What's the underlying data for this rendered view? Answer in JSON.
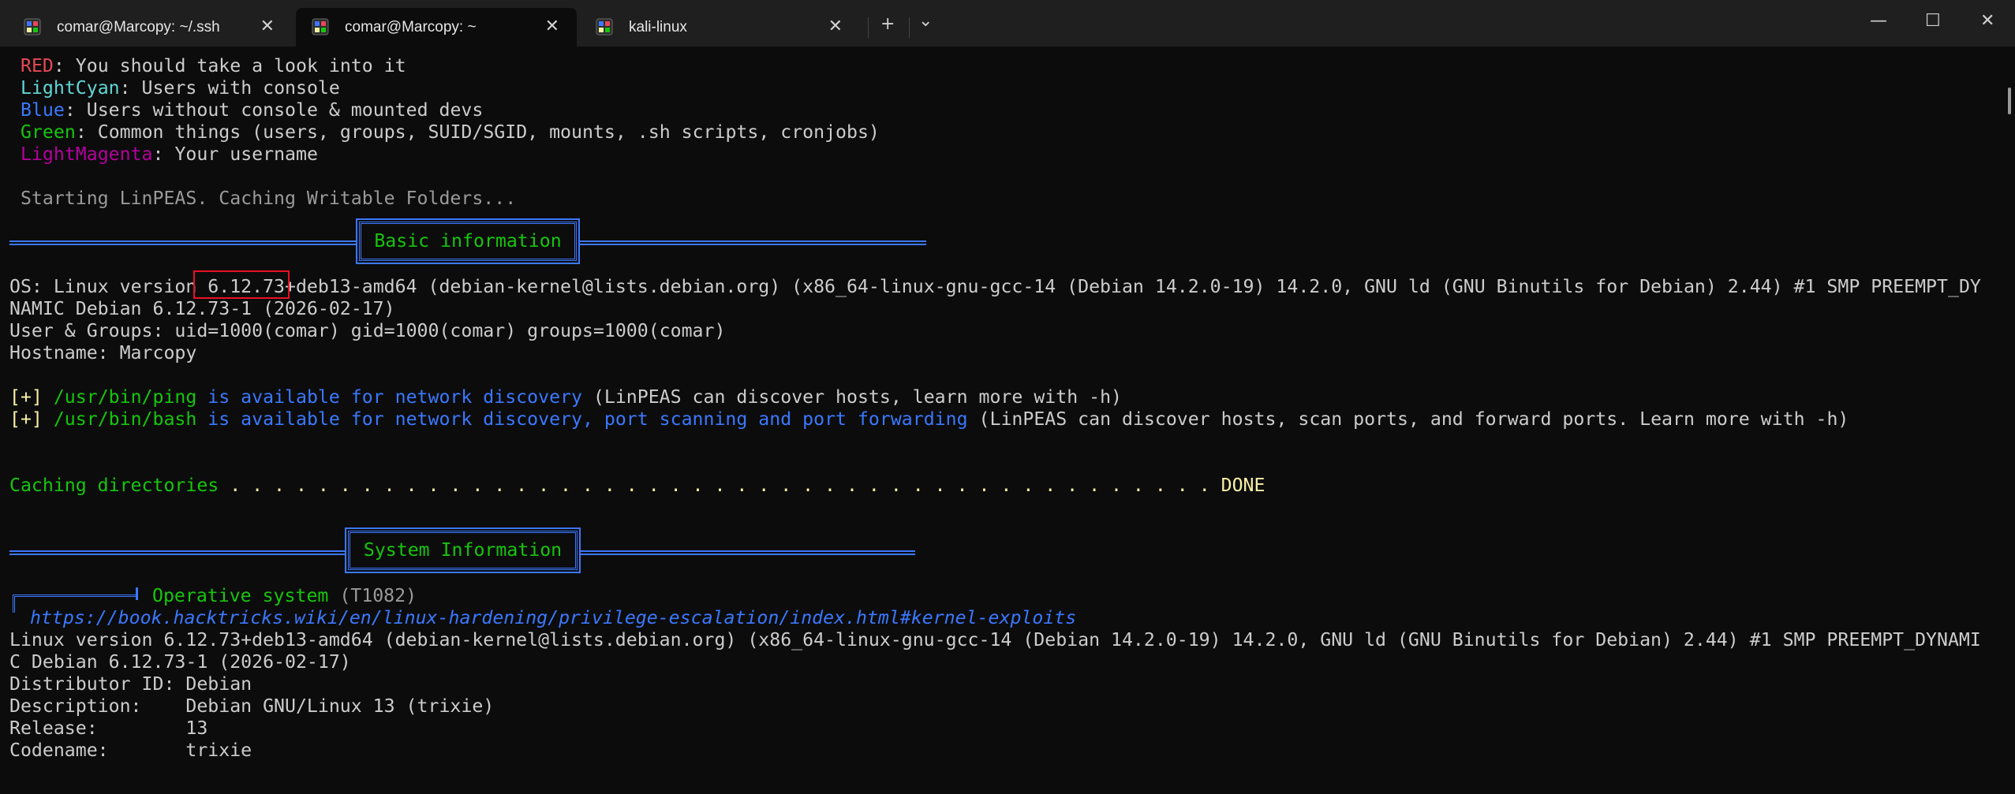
{
  "tabs": [
    {
      "label": "comar@Marcopy: ~/.ssh",
      "icon": "linux-penguin-icon"
    },
    {
      "label": "comar@Marcopy: ~",
      "icon": "linux-penguin-icon"
    },
    {
      "label": "kali-linux",
      "icon": "linux-penguin-icon"
    }
  ],
  "tab_close_glyph": "✕",
  "new_tab_glyph": "+",
  "dropdown_glyph": "⌄",
  "window": {
    "minimize": "—",
    "maximize": "☐",
    "close": "✕"
  },
  "legend": [
    {
      "key": "RED",
      "text": ": You should take a look into it"
    },
    {
      "key": "LightCyan",
      "text": ": Users with console"
    },
    {
      "key": "Blue",
      "text": ": Users without console & mounted devs"
    },
    {
      "key": "Green",
      "text": ": Common things (users, groups, SUID/SGID, mounts, .sh scripts, cronjobs)"
    },
    {
      "key": "LightMagenta",
      "text": ": Your username"
    }
  ],
  "starting": " Starting LinPEAS. Caching Writable Folders...",
  "basic_info": {
    "title": "Basic information",
    "os_label": "OS:",
    "os_line1": " Linux version 6.12.73+deb13-amd64 (debian-kernel@lists.debian.org) (x86_64-linux-gnu-gcc-14 (Debian 14.2.0-19) 14.2.0, GNU ld (GNU Binutils for Debian) 2.44) #1 SMP PREEMPT_DY",
    "os_line2": "NAMIC Debian 6.12.73-1 (2026-02-17)",
    "ug_label": "User & Groups:",
    "ug_value": " uid=1000(comar) gid=1000(comar) groups=1000(comar)",
    "host_label": "Hostname:",
    "host_value": " Marcopy"
  },
  "discovery": [
    {
      "prefix": "[+]",
      "path": " /usr/bin/ping",
      "desc": " is available for network discovery",
      "note": " (LinPEAS can discover hosts, learn more with -h)"
    },
    {
      "prefix": "[+]",
      "path": " /usr/bin/bash",
      "desc": " is available for network discovery, port scanning and port forwarding",
      "note": " (LinPEAS can discover hosts, scan ports, and forward ports. Learn more with -h)"
    }
  ],
  "caching": {
    "label": "Caching directories",
    "dots": " . . . . . . . . . . . . . . . . . . . . . . . . . . . . . . . . . . . . . . . . . . . . . ",
    "status": "DONE"
  },
  "system_info": {
    "title": "System Information",
    "section": "Operative system",
    "technique": " (T1082)",
    "link": "https://book.hacktricks.wiki/en/linux-hardening/privilege-escalation/index.html#kernel-exploits",
    "kernel_line1": "Linux version 6.12.73+deb13-amd64 (debian-kernel@lists.debian.org) (x86_64-linux-gnu-gcc-14 (Debian 14.2.0-19) 14.2.0, GNU ld (GNU Binutils for Debian) 2.44) #1 SMP PREEMPT_DYNAMI",
    "kernel_line2": "C Debian 6.12.73-1 (2026-02-17)",
    "lsb": [
      "Distributor ID: Debian",
      "Description:    Debian GNU/Linux 13 (trixie)",
      "Release:        13",
      "Codename:       trixie"
    ]
  },
  "colors": {
    "background": "#0c0c0c",
    "tabbar": "#1f1f1f",
    "red": "#e74856",
    "lightcyan": "#61d6d6",
    "blue": "#3b78ff",
    "green": "#16c60c",
    "lightmagenta": "#b4009e",
    "highlight_box": "#e81123"
  }
}
